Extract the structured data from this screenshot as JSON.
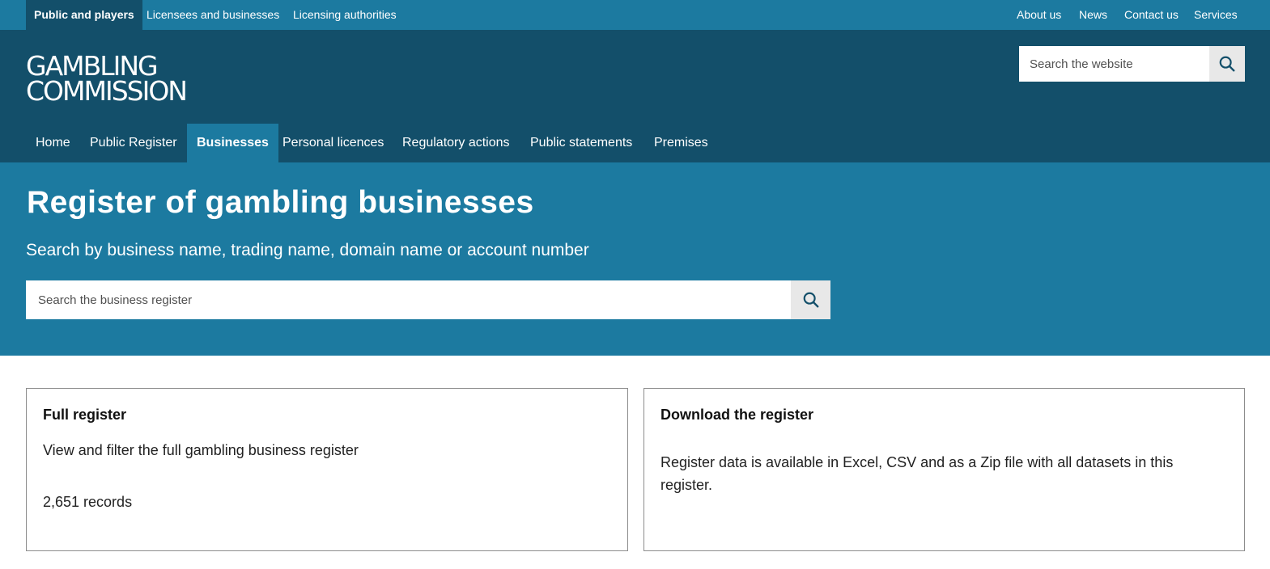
{
  "audience_bar": {
    "tabs": [
      "Public and players",
      "Licensees and businesses",
      "Licensing authorities"
    ],
    "active_tab": "Public and players",
    "utility_links": [
      "About us",
      "News",
      "Contact us",
      "Services"
    ]
  },
  "header": {
    "logo_line1": "GAMBLING",
    "logo_line2": "COMMISSION",
    "search": {
      "placeholder": "Search the website",
      "icon": "search-icon"
    }
  },
  "main_nav": {
    "items": [
      "Home",
      "Public Register",
      "Businesses",
      "Personal licences",
      "Regulatory actions",
      "Public statements",
      "Premises"
    ],
    "active_item": "Businesses"
  },
  "hero": {
    "title": "Register of gambling businesses",
    "subtitle": "Search by business name, trading name, domain name or account number",
    "search": {
      "placeholder": "Search the business register",
      "icon": "search-icon"
    }
  },
  "cards": {
    "full_register": {
      "title": "Full register",
      "description": "View and filter the full gambling business register",
      "count": "2,651 records"
    },
    "download": {
      "title": "Download the register",
      "description": "Register data is available in Excel, CSV and as a Zip file with all datasets in this register."
    }
  },
  "colors": {
    "light_blue": "#1c7aa0",
    "dark_blue": "#134f6a",
    "search_button_bg": "#e8e8e8",
    "card_border": "#8c8c8c"
  }
}
